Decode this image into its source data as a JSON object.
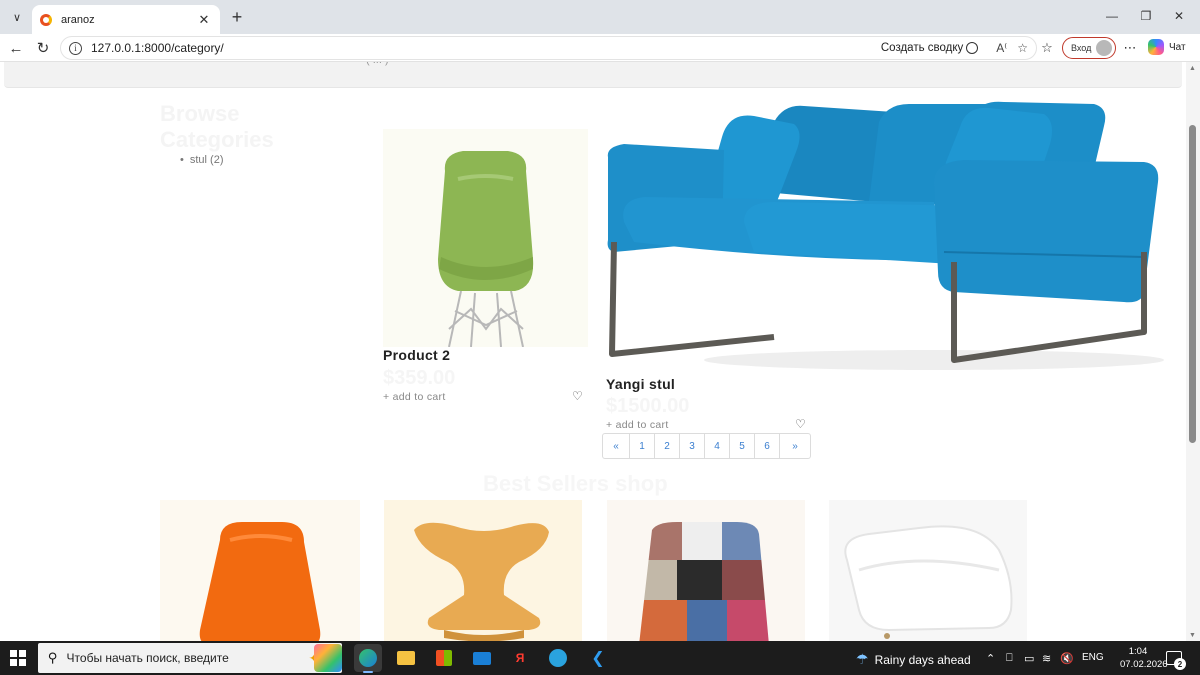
{
  "browser": {
    "tab_title": "aranoz",
    "url": "127.0.0.1:8000/category/",
    "summary_label": "Создать сводку",
    "login_label": "Вход",
    "chat_label": "Чат"
  },
  "page": {
    "top_strip_text": "( ... )",
    "browse_title": "Browse Categories",
    "categories": [
      {
        "label": "stul (2)"
      }
    ],
    "products": [
      {
        "name": "Product 2",
        "price": "$359.00",
        "cart_label": "+ add to cart",
        "image": "green-chair"
      },
      {
        "name": "Yangi stul",
        "price": "$1500.00",
        "cart_label": "+ add to cart",
        "image": "blue-sofa"
      }
    ],
    "pagination": {
      "first": "«",
      "pages": [
        "1",
        "2",
        "3",
        "4",
        "5",
        "6"
      ],
      "last": "»"
    },
    "best_sellers_title": "Best Sellers shop",
    "best_sellers": [
      {
        "image": "orange-chair"
      },
      {
        "image": "wooden-chair"
      },
      {
        "image": "patchwork-chair"
      },
      {
        "image": "white-armchair"
      }
    ]
  },
  "taskbar": {
    "search_placeholder": "Чтобы начать поиск, введите",
    "weather": "Rainy days ahead",
    "language": "ENG",
    "time": "1:04",
    "date": "07.02.2026",
    "notification_count": "2"
  },
  "colors": {
    "accent": "#3b7fd0",
    "sofa": "#1e8fc9",
    "green_chair": "#8db653",
    "orange_chair": "#f26a10",
    "taskbar": "#1c1c1c"
  }
}
